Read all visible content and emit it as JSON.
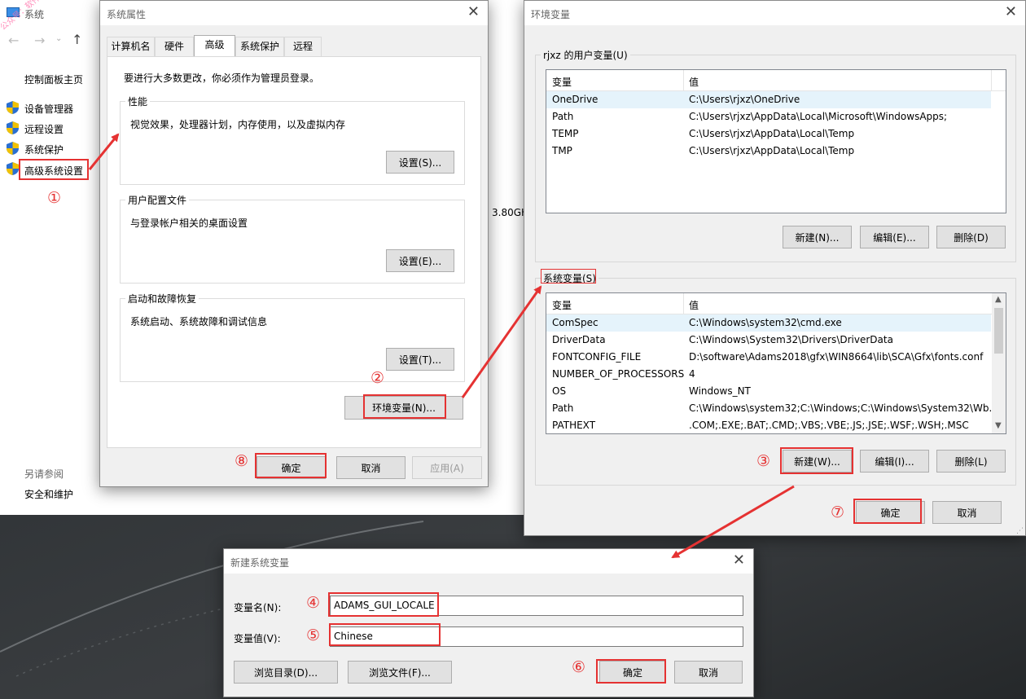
{
  "watermark": "公众号：软件刈静",
  "bg_window": {
    "title": "系统",
    "cp_home": "控制面板主页",
    "links": [
      "设备管理器",
      "远程设置",
      "系统保护",
      "高级系统设置"
    ],
    "cpu_fragment": "3.80GH",
    "see_also": "另请参阅",
    "security": "安全和维护"
  },
  "sysprop": {
    "title": "系统属性",
    "tabs": [
      "计算机名",
      "硬件",
      "高级",
      "系统保护",
      "远程"
    ],
    "active_tab": "高级",
    "admin_note": "要进行大多数更改，你必须作为管理员登录。",
    "perf_title": "性能",
    "perf_desc": "视觉效果，处理器计划，内存使用，以及虚拟内存",
    "perf_btn": "设置(S)...",
    "profile_title": "用户配置文件",
    "profile_desc": "与登录帐户相关的桌面设置",
    "profile_btn": "设置(E)...",
    "startup_title": "启动和故障恢复",
    "startup_desc": "系统启动、系统故障和调试信息",
    "startup_btn": "设置(T)...",
    "env_btn": "环境变量(N)...",
    "ok": "确定",
    "cancel": "取消",
    "apply": "应用(A)"
  },
  "envvars": {
    "title": "环境变量",
    "user_group": "rjxz 的用户变量(U)",
    "col_var": "变量",
    "col_val": "值",
    "user_vars": [
      {
        "name": "OneDrive",
        "value": "C:\\Users\\rjxz\\OneDrive"
      },
      {
        "name": "Path",
        "value": "C:\\Users\\rjxz\\AppData\\Local\\Microsoft\\WindowsApps;"
      },
      {
        "name": "TEMP",
        "value": "C:\\Users\\rjxz\\AppData\\Local\\Temp"
      },
      {
        "name": "TMP",
        "value": "C:\\Users\\rjxz\\AppData\\Local\\Temp"
      }
    ],
    "user_new": "新建(N)...",
    "user_edit": "编辑(E)...",
    "user_delete": "删除(D)",
    "sys_group": "系统变量(S)",
    "sys_vars": [
      {
        "name": "ComSpec",
        "value": "C:\\Windows\\system32\\cmd.exe"
      },
      {
        "name": "DriverData",
        "value": "C:\\Windows\\System32\\Drivers\\DriverData"
      },
      {
        "name": "FONTCONFIG_FILE",
        "value": "D:\\software\\Adams2018\\gfx\\WIN8664\\lib\\SCA\\Gfx\\fonts.conf"
      },
      {
        "name": "NUMBER_OF_PROCESSORS",
        "value": "4"
      },
      {
        "name": "OS",
        "value": "Windows_NT"
      },
      {
        "name": "Path",
        "value": "C:\\Windows\\system32;C:\\Windows;C:\\Windows\\System32\\Wb..."
      },
      {
        "name": "PATHEXT",
        "value": ".COM;.EXE;.BAT;.CMD;.VBS;.VBE;.JS;.JSE;.WSF;.WSH;.MSC"
      }
    ],
    "sys_new": "新建(W)...",
    "sys_edit": "编辑(I)...",
    "sys_delete": "删除(L)",
    "ok": "确定",
    "cancel": "取消"
  },
  "newvar": {
    "title": "新建系统变量",
    "name_label": "变量名(N):",
    "name_value": "ADAMS_GUI_LOCALE",
    "value_label": "变量值(V):",
    "value_value": "Chinese",
    "browse_dir": "浏览目录(D)...",
    "browse_file": "浏览文件(F)...",
    "ok": "确定",
    "cancel": "取消"
  },
  "steps": [
    "①",
    "②",
    "③",
    "④",
    "⑤",
    "⑥",
    "⑦",
    "⑧"
  ],
  "colors": {
    "annotation_red": "#e53232",
    "selection": "#e5f3fb",
    "shield_blue": "#2a6fd1",
    "shield_yellow": "#f2c200"
  }
}
